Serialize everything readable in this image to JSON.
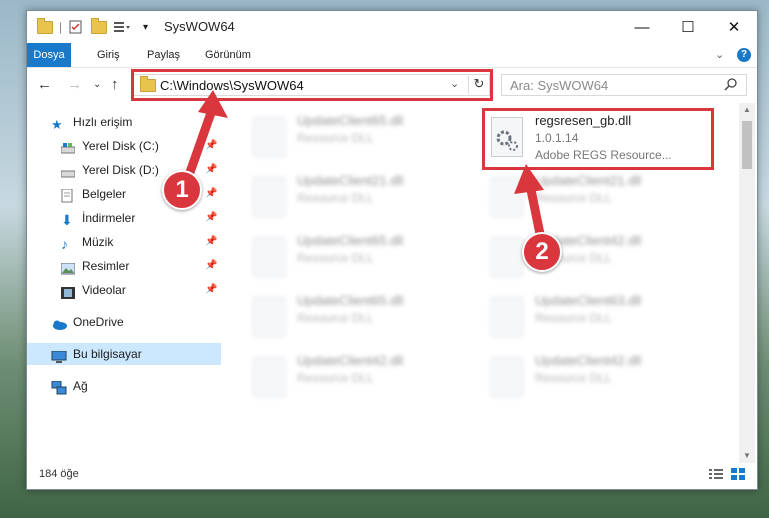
{
  "window": {
    "title": "SysWOW64"
  },
  "ribbon": {
    "tabs": [
      "Dosya",
      "Giriş",
      "Paylaş",
      "Görünüm"
    ]
  },
  "nav": {
    "address": "C:\\Windows\\SysWOW64",
    "search_placeholder": "Ara: SysWOW64"
  },
  "sidebar": {
    "items": [
      {
        "label": "Hızlı erişim"
      },
      {
        "label": "Yerel Disk (C:)"
      },
      {
        "label": "Yerel Disk (D:)"
      },
      {
        "label": "Belgeler"
      },
      {
        "label": "İndirmeler"
      },
      {
        "label": "Müzik"
      },
      {
        "label": "Resimler"
      },
      {
        "label": "Videolar"
      },
      {
        "label": "OneDrive"
      },
      {
        "label": "Bu bilgisayar"
      },
      {
        "label": "Ağ"
      }
    ]
  },
  "files": {
    "left": [
      {
        "name": "UpdateClient65.dll",
        "type": "Resource DLL"
      },
      {
        "name": "UpdateClient21.dll",
        "type": "Resource DLL"
      },
      {
        "name": "UpdateClient65.dll",
        "type": "Resource DLL"
      },
      {
        "name": "UpdateClient65.dll",
        "type": "Resource DLL"
      },
      {
        "name": "UpdateClient42.dll",
        "type": "Resource DLL"
      }
    ],
    "right": [
      {
        "name": "UpdateClient21.dll",
        "type": "Resource DLL"
      },
      {
        "name": "UpdateClient42.dll",
        "type": "Resource DLL"
      },
      {
        "name": "UpdateClient63.dll",
        "type": "Resource DLL"
      },
      {
        "name": "UpdateClient42.dll",
        "type": "Resource DLL"
      }
    ],
    "highlighted": {
      "name": "regsresen_gb.dll",
      "version": "1.0.1.14",
      "description": "Adobe REGS Resource..."
    }
  },
  "status": {
    "count": "184 öğe"
  },
  "annotations": {
    "badge1": "1",
    "badge2": "2",
    "color": "#d9363e"
  }
}
